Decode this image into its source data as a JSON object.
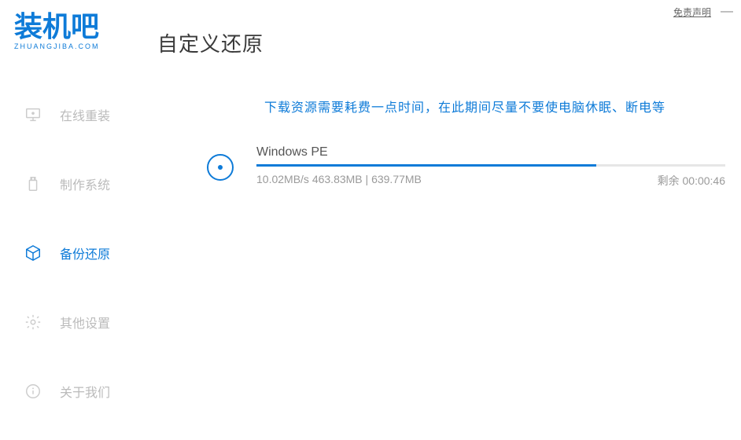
{
  "topbar": {
    "disclaimer": "免责声明",
    "minimize": "—"
  },
  "logo": {
    "brand_cn": "装机吧",
    "brand_url": "ZHUANGJIBA.COM"
  },
  "sidebar": {
    "items": [
      {
        "label": "在线重装",
        "icon": "monitor-icon"
      },
      {
        "label": "制作系统",
        "icon": "usb-icon"
      },
      {
        "label": "备份还原",
        "icon": "cube-icon"
      },
      {
        "label": "其他设置",
        "icon": "gear-icon"
      },
      {
        "label": "关于我们",
        "icon": "info-icon"
      }
    ],
    "active_index": 2
  },
  "main": {
    "title": "自定义还原",
    "notice": "下载资源需要耗费一点时间，在此期间尽量不要使电脑休眠、断电等",
    "download": {
      "name": "Windows PE",
      "speed": "10.02MB/s",
      "downloaded": "463.83MB",
      "total": "639.77MB",
      "percent": 72.5,
      "remaining_label": "剩余",
      "remaining_time": "00:00:46"
    }
  },
  "colors": {
    "primary": "#0e7bd8",
    "muted": "#bbbbbb",
    "text": "#555555"
  }
}
